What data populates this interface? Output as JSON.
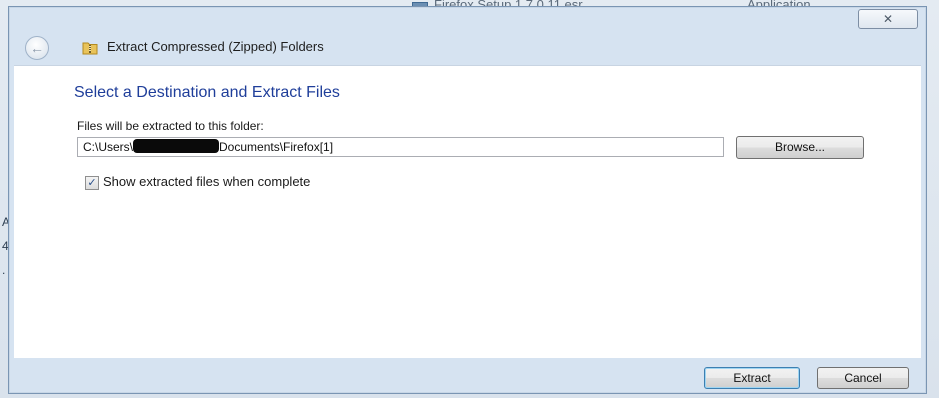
{
  "background": {
    "file_name": "Firefox Setup 1.7.0.11.esr",
    "file_type": "Application",
    "left_marks": [
      "A",
      "4",
      "."
    ]
  },
  "dialog": {
    "close_label": "✕",
    "back_icon": "back-arrow-icon",
    "folder_icon": "zip-folder-icon",
    "title": "Extract Compressed (Zipped) Folders",
    "heading": "Select a Destination and Extract Files",
    "folder_label": "Files will be extracted to this folder:",
    "path_prefix": "C:\\Users\\",
    "path_suffix": "Documents\\Firefox[1]",
    "browse_label": "Browse...",
    "show_files_checked": true,
    "show_files_label": "Show extracted files when complete",
    "extract_label": "Extract",
    "cancel_label": "Cancel"
  },
  "colors": {
    "heading": "#1f3e9a",
    "dialog_frame": "#d6e3f1"
  }
}
